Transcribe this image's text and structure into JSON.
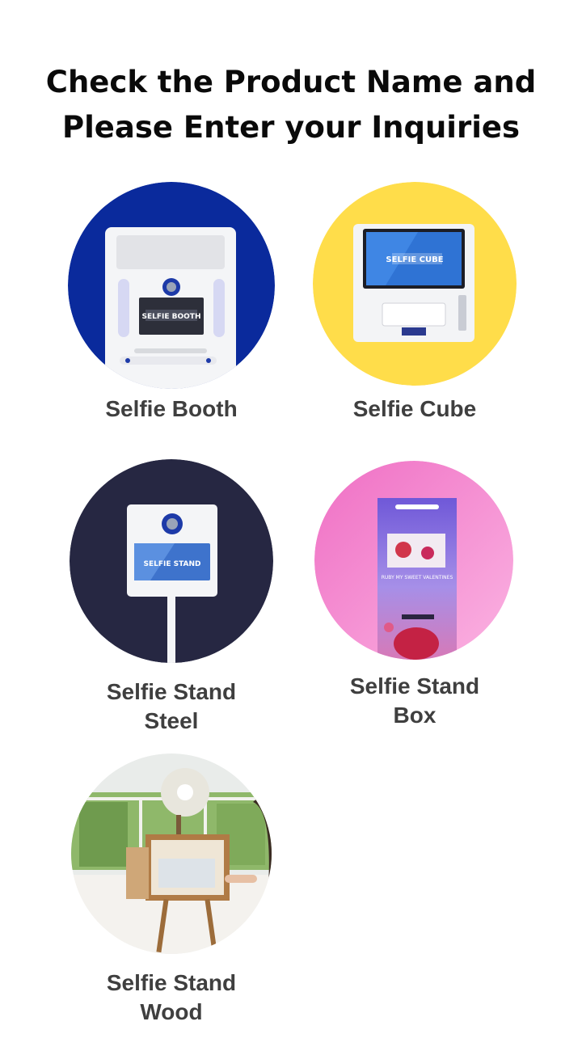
{
  "header": {
    "title_line1": "Check the Product Name and",
    "title_line2": "Please Enter your Inquiries"
  },
  "products": [
    {
      "label_line1": "Selfie Booth",
      "label_line2": "",
      "bg_color": "#0A2A9C",
      "screen_text": "SELFIE BOOTH",
      "icon": "selfie-booth-kiosk-image"
    },
    {
      "label_line1": "Selfie Cube",
      "label_line2": "",
      "bg_color": "#FFDD4A",
      "screen_text": "SELFIE CUBE",
      "icon": "selfie-cube-kiosk-image"
    },
    {
      "label_line1": "Selfie Stand",
      "label_line2": "Steel",
      "bg_color": "#262742",
      "screen_text": "SELFIE STAND",
      "icon": "selfie-stand-steel-image"
    },
    {
      "label_line1": "Selfie Stand",
      "label_line2": "Box",
      "bg_color": "#F07AC8",
      "screen_text": "RUBY MY SWEET VALENTINES",
      "icon": "selfie-stand-box-image"
    },
    {
      "label_line1": "Selfie Stand",
      "label_line2": "Wood",
      "bg_color": "#E9ECEA",
      "screen_text": "",
      "icon": "selfie-stand-wood-image"
    }
  ]
}
